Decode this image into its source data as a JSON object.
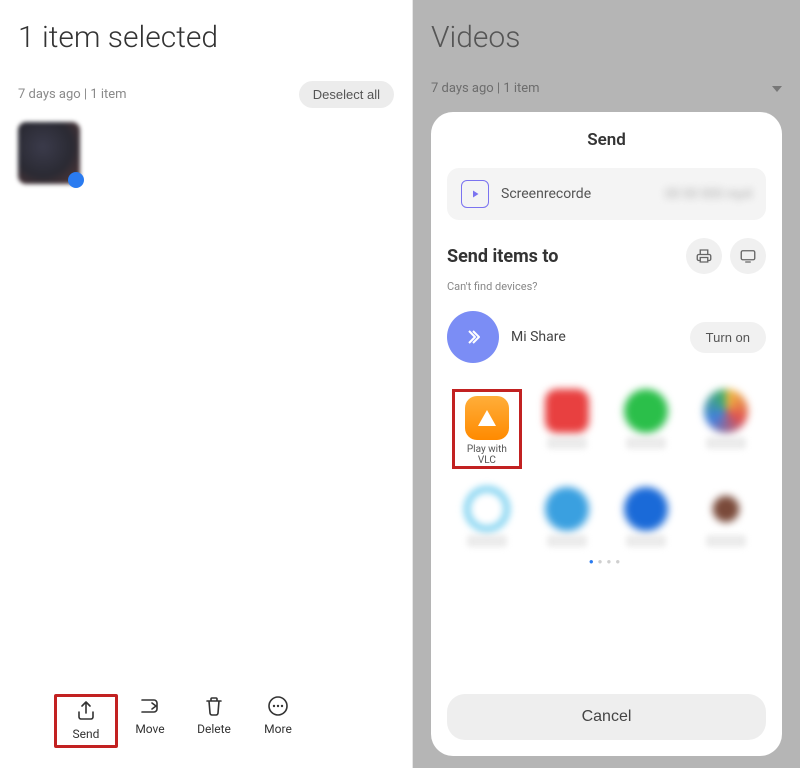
{
  "left": {
    "title": "1 item selected",
    "meta": "7 days ago  |  1 item",
    "deselect": "Deselect all",
    "actions": {
      "send": "Send",
      "move": "Move",
      "delete": "Delete",
      "more": "More"
    }
  },
  "right": {
    "title": "Videos",
    "meta": "7 days ago  |  1 item"
  },
  "sheet": {
    "title": "Send",
    "file_name": "Screenrecorde",
    "send_to_title": "Send items to",
    "send_to_sub": "Can't find devices?",
    "mishare_label": "Mi Share",
    "turn_on": "Turn on",
    "vlc_label": "Play with VLC",
    "cancel": "Cancel"
  }
}
